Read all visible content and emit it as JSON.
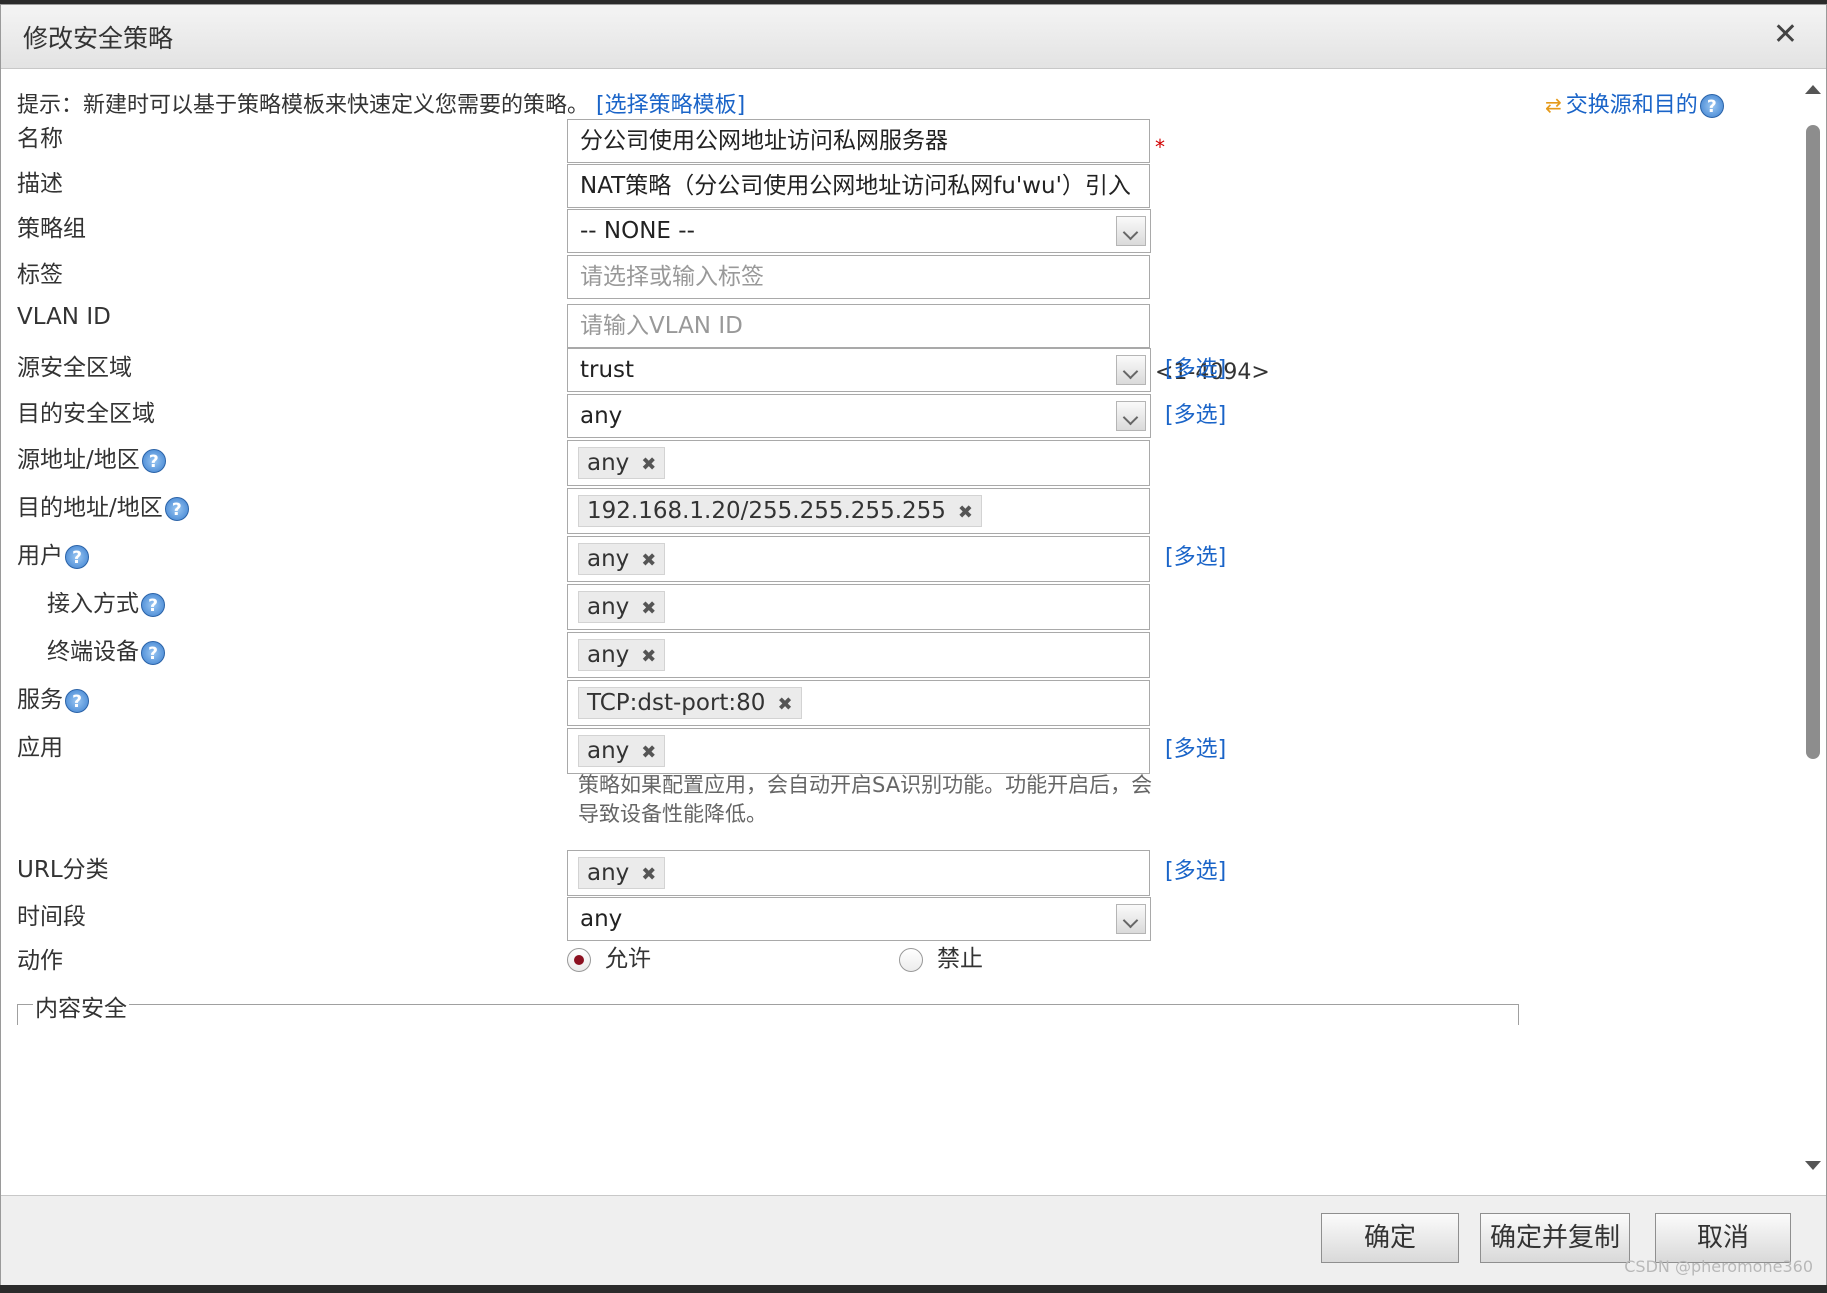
{
  "dialog": {
    "title": "修改安全策略",
    "close": "✕"
  },
  "hint": {
    "text": "提示：新建时可以基于策略模板来快速定义您需要的策略。",
    "link": "[选择策略模板]"
  },
  "swap": {
    "label": "交换源和目的",
    "icon": "⇄"
  },
  "help_glyph": "?",
  "required_mark": "*",
  "multi_select": "[多选]",
  "fields": {
    "name": {
      "label": "名称",
      "value": "分公司使用公网地址访问私网服务器"
    },
    "desc": {
      "label": "描述",
      "value": "NAT策略（分公司使用公网地址访问私网fu'wu'）引入"
    },
    "group": {
      "label": "策略组",
      "value": "-- NONE --"
    },
    "tags": {
      "label": "标签",
      "placeholder": "请选择或输入标签"
    },
    "vlan": {
      "label": "VLAN ID",
      "placeholder": "请输入VLAN ID",
      "range": "<1-4094>"
    },
    "src_zone": {
      "label": "源安全区域",
      "value": "trust"
    },
    "dst_zone": {
      "label": "目的安全区域",
      "value": "any"
    },
    "src_addr": {
      "label": "源地址/地区",
      "tag": "any"
    },
    "dst_addr": {
      "label": "目的地址/地区",
      "tag": "192.168.1.20/255.255.255.255"
    },
    "user": {
      "label": "用户",
      "tag": "any"
    },
    "access": {
      "label": "接入方式",
      "tag": "any"
    },
    "terminal": {
      "label": "终端设备",
      "tag": "any"
    },
    "service": {
      "label": "服务",
      "tag": "TCP:dst-port:80"
    },
    "app": {
      "label": "应用",
      "tag": "any",
      "note": "策略如果配置应用，会自动开启SA识别功能。功能开启后，会导致设备性能降低。"
    },
    "url": {
      "label": "URL分类",
      "tag": "any"
    },
    "time": {
      "label": "时间段",
      "value": "any"
    },
    "action": {
      "label": "动作",
      "allow": "允许",
      "deny": "禁止",
      "selected": "allow"
    }
  },
  "section": {
    "content_security": "内容安全"
  },
  "tag_remove": "✖",
  "buttons": {
    "ok": "确定",
    "ok_copy": "确定并复制",
    "cancel": "取消"
  },
  "watermark": "CSDN @pheromone360"
}
